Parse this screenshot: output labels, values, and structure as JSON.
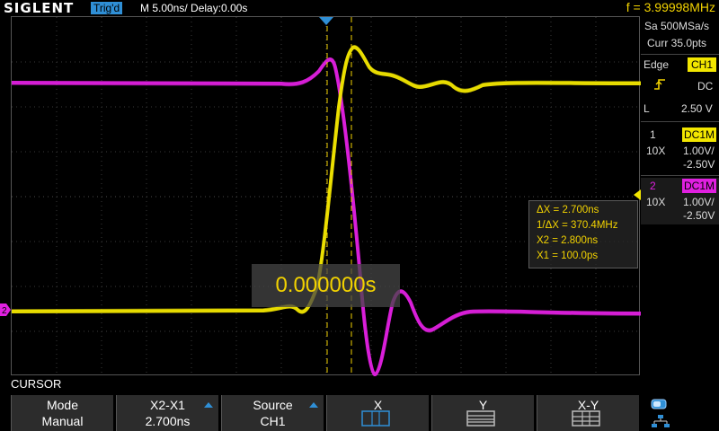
{
  "header": {
    "brand": "SIGLENT",
    "trigger_status": "Trig'd",
    "timebase": "M 5.00ns/",
    "delay": "Delay:0.00s",
    "frequency": "f = 3.99998MHz"
  },
  "sidebar": {
    "sample_rate": "Sa 500MSa/s",
    "memory": "Curr 35.0pts",
    "trigger": {
      "type": "Edge",
      "source": "CH1",
      "coupling": "DC",
      "level_label": "L",
      "level_value": "2.50 V"
    },
    "channels": [
      {
        "number": "1",
        "coupling": "DC1M",
        "probe": "10X",
        "scale": "1.00V/",
        "offset": "-2.50V",
        "color": "#f2e600"
      },
      {
        "number": "2",
        "coupling": "DC1M",
        "probe": "10X",
        "scale": "1.00V/",
        "offset": "-2.50V",
        "color": "#e020e0"
      }
    ]
  },
  "measurements": {
    "dx": "ΔX = 2.700ns",
    "inv_dx": "1/ΔX = 370.4MHz",
    "x2": "X2 = 2.800ns",
    "x1": "X1 = 100.0ps"
  },
  "time_readout": "0.000000s",
  "menu": {
    "title": "CURSOR",
    "keys": [
      {
        "line1": "Mode",
        "line2": "Manual"
      },
      {
        "line1": "X2-X1",
        "line2": "2.700ns"
      },
      {
        "line1": "Source",
        "line2": "CH1"
      },
      {
        "line1": "X",
        "line2": ""
      },
      {
        "line1": "Y",
        "line2": ""
      },
      {
        "line1": "X-Y",
        "line2": ""
      }
    ]
  },
  "colors": {
    "ch1": "#f2e600",
    "ch2": "#e020e0",
    "accent": "#2f8fd6",
    "cursor": "#f2d200"
  }
}
